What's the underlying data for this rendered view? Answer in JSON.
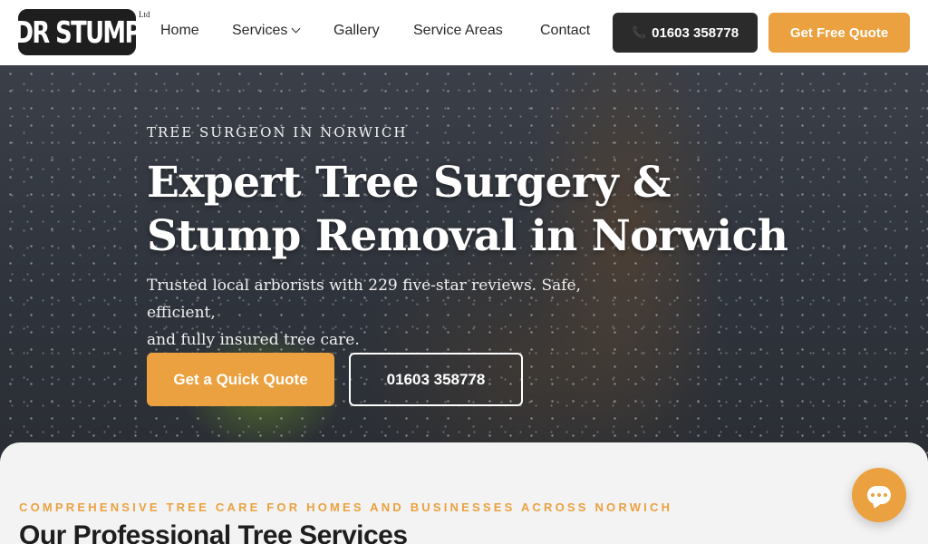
{
  "header": {
    "logo_text": "DR STUMP",
    "logo_suffix": "Ltd",
    "nav": [
      {
        "label": "Home"
      },
      {
        "label": "Services"
      },
      {
        "label": "Gallery"
      },
      {
        "label": "Service Areas"
      },
      {
        "label": "Contact"
      }
    ],
    "phone_button": {
      "label": "01603 358778",
      "icon": "phone-icon"
    },
    "quote_button": {
      "label": "Get Free Quote"
    }
  },
  "hero": {
    "kicker": "TREE SURGEON IN NORWICH",
    "title_line1": "Expert Tree Surgery &",
    "title_line2": "Stump Removal in Norwich",
    "subtitle_line1": "Trusted local arborists with 229 five-star reviews. Safe, efficient,",
    "subtitle_line2": "and fully insured tree care.",
    "primary_button": "Get a Quick Quote",
    "secondary_button": "01603 358778"
  },
  "services": {
    "kicker": "COMPREHENSIVE TREE CARE FOR HOMES AND BUSINESSES ACROSS NORWICH",
    "title": "Our Professional Tree Services"
  },
  "chat": {
    "icon": "chat-bubble-icon"
  },
  "colors": {
    "accent": "#eba13f",
    "dark": "#2b2b2b"
  }
}
